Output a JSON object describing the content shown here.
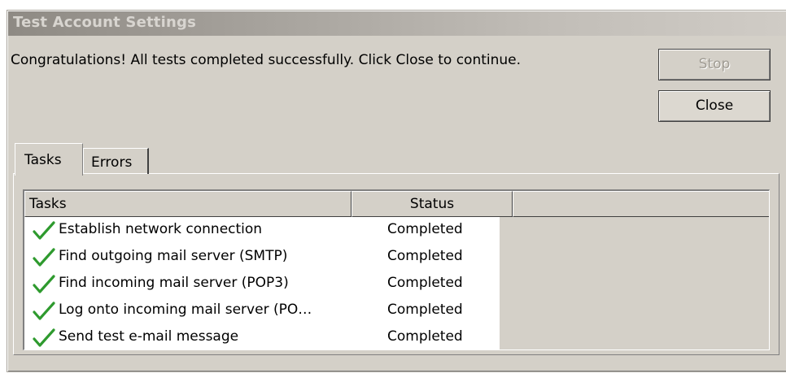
{
  "window": {
    "title": "Test Account Settings"
  },
  "message": "Congratulations! All tests completed successfully. Click Close to continue.",
  "buttons": {
    "stop_label": "Stop",
    "close_label": "Close"
  },
  "tabs": [
    {
      "label": "Tasks",
      "selected": true
    },
    {
      "label": "Errors",
      "selected": false
    }
  ],
  "table": {
    "columns": [
      "Tasks",
      "Status"
    ],
    "rows": [
      {
        "task": "Establish network connection",
        "status": "Completed",
        "icon": "check-icon"
      },
      {
        "task": "Find outgoing mail server (SMTP)",
        "status": "Completed",
        "icon": "check-icon"
      },
      {
        "task": "Find incoming mail server (POP3)",
        "status": "Completed",
        "icon": "check-icon"
      },
      {
        "task": "Log onto incoming mail server (PO…",
        "status": "Completed",
        "icon": "check-icon"
      },
      {
        "task": "Send test e-mail message",
        "status": "Completed",
        "icon": "check-icon"
      }
    ]
  },
  "colors": {
    "dialog_face": "#d4d0c8",
    "check_green": "#2e9a2e",
    "disabled_text": "#a09c94"
  }
}
